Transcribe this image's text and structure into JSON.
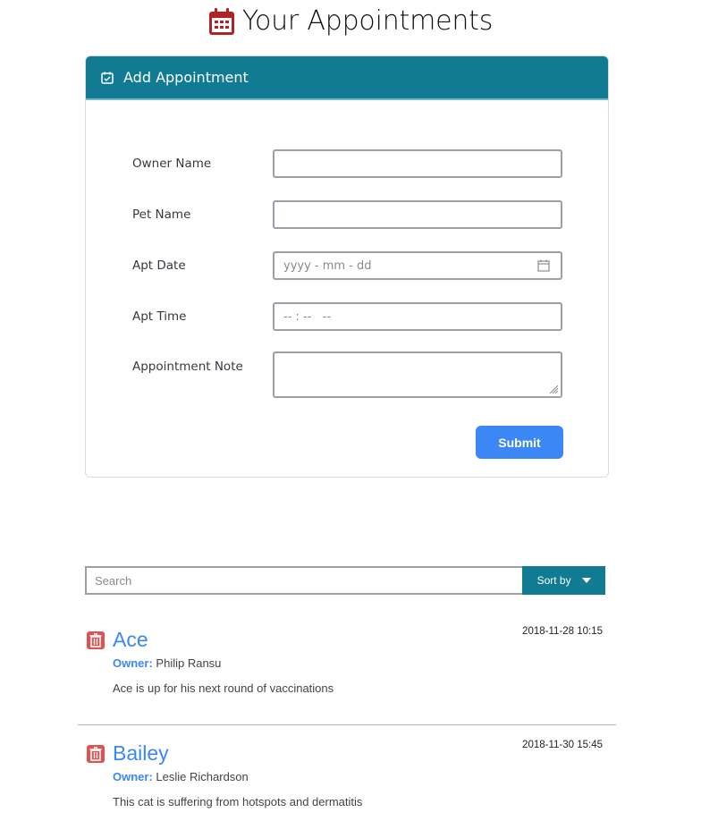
{
  "header": {
    "title": "Your Appointments",
    "icon": "calendar-icon",
    "icon_color": "#b22222"
  },
  "add_card": {
    "title": "Add Appointment",
    "header_color": "#107b93",
    "labels": {
      "owner_name": "Owner Name",
      "pet_name": "Pet Name",
      "apt_date": "Apt Date",
      "apt_time": "Apt Time",
      "apt_note": "Appointment Note"
    },
    "inputs": {
      "owner_name_value": "",
      "pet_name_value": "",
      "apt_date_placeholder": "yyyy - mm - dd",
      "apt_time_placeholder": "-- : --   --",
      "apt_note_value": ""
    },
    "submit_label": "Submit",
    "submit_color": "#3b87f5"
  },
  "toolbar": {
    "search_placeholder": "Search",
    "sort_label": "Sort by"
  },
  "appointments": [
    {
      "pet_name": "Ace",
      "date": "2018-11-28 10:15",
      "owner_label": "Owner:",
      "owner": "Philip Ransu",
      "note": "Ace is up for his next round of vaccinations"
    },
    {
      "pet_name": "Bailey",
      "date": "2018-11-30 15:45",
      "owner_label": "Owner:",
      "owner": "Leslie Richardson",
      "note": "This cat is suffering from hotspots and dermatitis"
    }
  ],
  "accent_color": "#3b87f5",
  "delete_color": "#e05252"
}
